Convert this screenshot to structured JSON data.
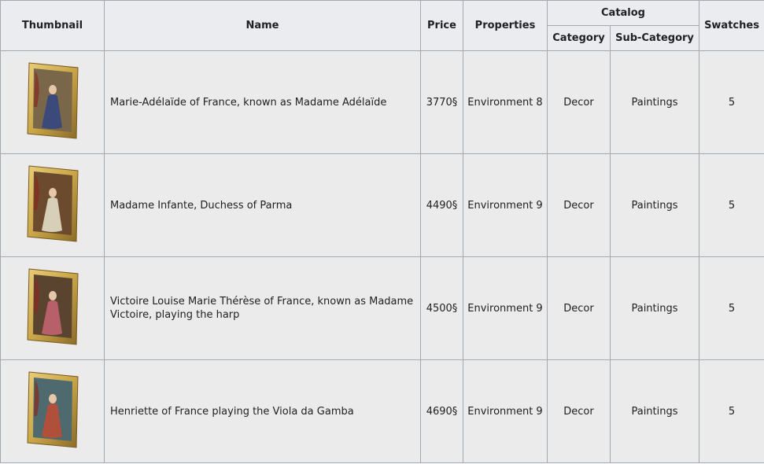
{
  "headers": {
    "thumbnail": "Thumbnail",
    "name": "Name",
    "price": "Price",
    "properties": "Properties",
    "catalog": "Catalog",
    "category": "Category",
    "subcategory": "Sub-Category",
    "swatches": "Swatches"
  },
  "rows": [
    {
      "name": "Marie-Adélaïde of France, known as Madame Adélaïde",
      "price": "3770§",
      "properties": "Environment 8",
      "category": "Decor",
      "subcategory": "Paintings",
      "swatches": "5",
      "thumb": {
        "icon": "framed-portrait-icon",
        "bg": "#7a6648",
        "figure": "#3b4a7a",
        "frame": "#c9a648"
      }
    },
    {
      "name": "Madame Infante, Duchess of Parma",
      "price": "4490§",
      "properties": "Environment 9",
      "category": "Decor",
      "subcategory": "Paintings",
      "swatches": "5",
      "thumb": {
        "icon": "framed-portrait-icon",
        "bg": "#6b4a2e",
        "figure": "#d8cfb8",
        "frame": "#c9a648"
      }
    },
    {
      "name": "Victoire Louise Marie Thérèse of France, known as Madame Victoire, playing the harp",
      "price": "4500§",
      "properties": "Environment 9",
      "category": "Decor",
      "subcategory": "Paintings",
      "swatches": "5",
      "thumb": {
        "icon": "framed-portrait-icon",
        "bg": "#5a4430",
        "figure": "#b8606a",
        "frame": "#c9a648"
      }
    },
    {
      "name": "Henriette of France playing the Viola da Gamba",
      "price": "4690§",
      "properties": "Environment 9",
      "category": "Decor",
      "subcategory": "Paintings",
      "swatches": "5",
      "thumb": {
        "icon": "framed-portrait-icon",
        "bg": "#4e6a6e",
        "figure": "#b0503a",
        "frame": "#c9a648"
      }
    }
  ]
}
